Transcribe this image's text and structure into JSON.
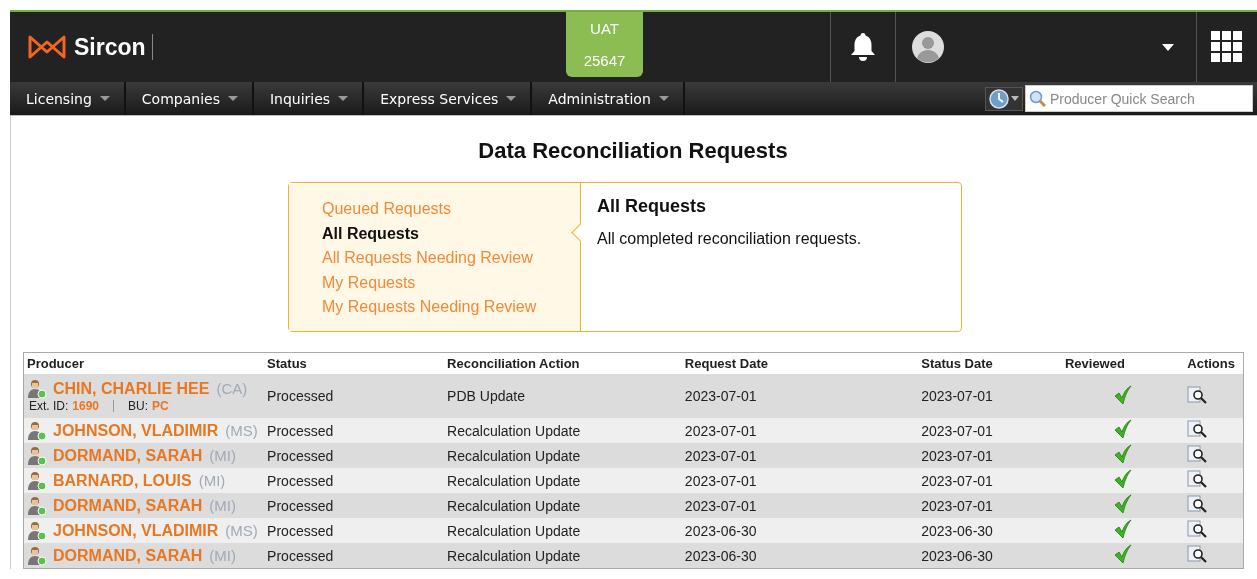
{
  "header": {
    "brand": "Sircon",
    "env": {
      "name": "UAT",
      "number": "25647"
    }
  },
  "nav": {
    "menus": [
      {
        "label": "Licensing"
      },
      {
        "label": "Companies"
      },
      {
        "label": "Inquiries"
      },
      {
        "label": "Express Services"
      },
      {
        "label": "Administration"
      }
    ],
    "search": {
      "placeholder": "Producer Quick Search"
    }
  },
  "page": {
    "title": "Data Reconciliation Requests"
  },
  "filters": {
    "items": [
      {
        "label": "Queued Requests",
        "selected": false
      },
      {
        "label": "All Requests",
        "selected": true
      },
      {
        "label": "All Requests Needing Review",
        "selected": false
      },
      {
        "label": "My Requests",
        "selected": false
      },
      {
        "label": "My Requests Needing Review",
        "selected": false
      }
    ],
    "detail": {
      "title": "All Requests",
      "description": "All completed reconciliation requests."
    }
  },
  "table": {
    "columns": [
      "Producer",
      "Status",
      "Reconciliation Action",
      "Request Date",
      "Status Date",
      "Reviewed",
      "Actions"
    ],
    "rows": [
      {
        "producer": "CHIN, CHARLIE HEE",
        "state": "(CA)",
        "ext_label": "Ext. ID:",
        "ext_id": "1690",
        "bu_label": "BU:",
        "bu": "PC",
        "status": "Processed",
        "action": "PDB Update",
        "request_date": "2023-07-01",
        "status_date": "2023-07-01",
        "reviewed": true
      },
      {
        "producer": "JOHNSON, VLADIMIR",
        "state": "(MS)",
        "status": "Processed",
        "action": "Recalculation Update",
        "request_date": "2023-07-01",
        "status_date": "2023-07-01",
        "reviewed": true
      },
      {
        "producer": "DORMAND, SARAH",
        "state": "(MI)",
        "status": "Processed",
        "action": "Recalculation Update",
        "request_date": "2023-07-01",
        "status_date": "2023-07-01",
        "reviewed": true
      },
      {
        "producer": "BARNARD, LOUIS",
        "state": "(MI)",
        "status": "Processed",
        "action": "Recalculation Update",
        "request_date": "2023-07-01",
        "status_date": "2023-07-01",
        "reviewed": true
      },
      {
        "producer": "DORMAND, SARAH",
        "state": "(MI)",
        "status": "Processed",
        "action": "Recalculation Update",
        "request_date": "2023-07-01",
        "status_date": "2023-07-01",
        "reviewed": true
      },
      {
        "producer": "JOHNSON, VLADIMIR",
        "state": "(MS)",
        "status": "Processed",
        "action": "Recalculation Update",
        "request_date": "2023-06-30",
        "status_date": "2023-06-30",
        "reviewed": true
      },
      {
        "producer": "DORMAND, SARAH",
        "state": "(MI)",
        "status": "Processed",
        "action": "Recalculation Update",
        "request_date": "2023-06-30",
        "status_date": "2023-06-30",
        "reviewed": true
      }
    ]
  }
}
